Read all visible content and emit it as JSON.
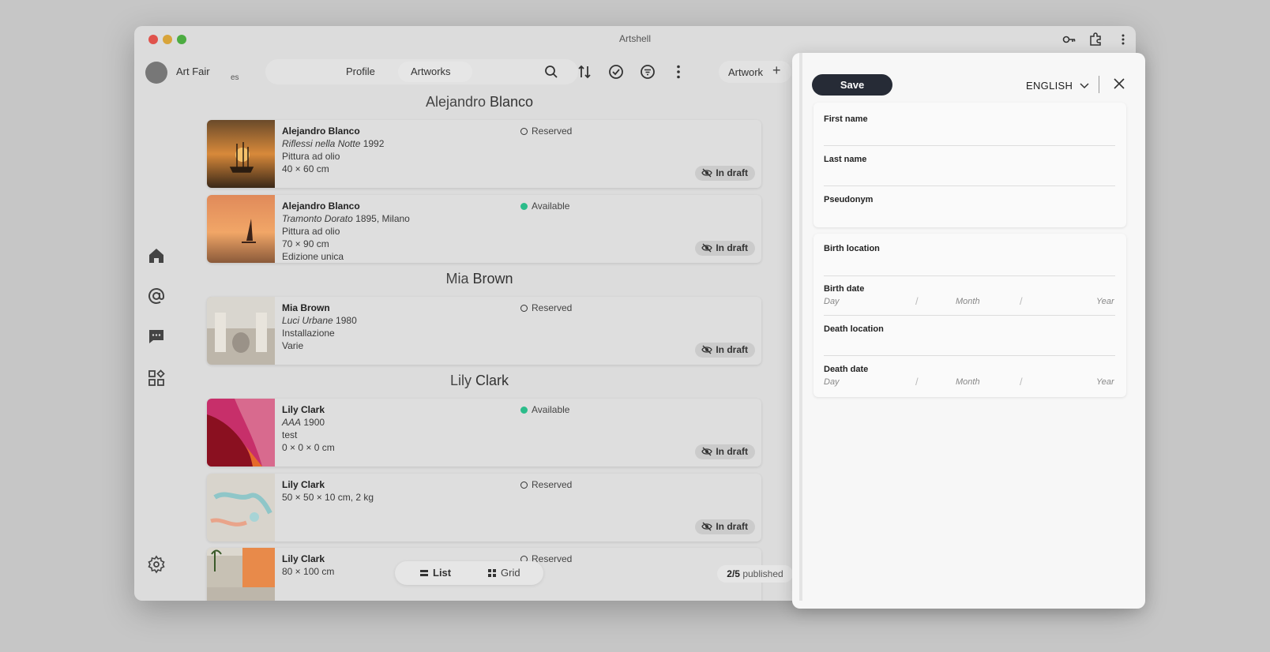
{
  "window": {
    "title": "Artshell"
  },
  "org": {
    "name": "Art Fair",
    "sub": "es"
  },
  "nav": {
    "tabs": [
      "Profile",
      "Artworks"
    ],
    "active": "Artworks"
  },
  "toolbar": {
    "artwork_label": "Artwork",
    "artwork_plus": "+"
  },
  "headings": {
    "h1": {
      "first": "Alejandro",
      "last": "Blanco"
    },
    "h2": {
      "first": "Mia",
      "last": "Brown"
    },
    "h3": {
      "first": "Lily",
      "last": "Clark"
    }
  },
  "cards": [
    {
      "artist": "Alejandro Blanco",
      "title_italic": "Riflessi nella Notte",
      "title_rest": " 1992",
      "l3": "Pittura ad olio",
      "l4": "40 × 60 cm",
      "l5": "",
      "status": "Reserved",
      "status_type": "reserved",
      "badge": "In draft"
    },
    {
      "artist": "Alejandro Blanco",
      "title_italic": "Tramonto Dorato",
      "title_rest": " 1895, Milano",
      "l3": "Pittura ad olio",
      "l4": "70 × 90 cm",
      "l5": "Edizione unica",
      "status": "Available",
      "status_type": "available",
      "badge": "In draft"
    },
    {
      "artist": "Mia Brown",
      "title_italic": "Luci Urbane",
      "title_rest": " 1980",
      "l3": "Installazione",
      "l4": "Varie",
      "l5": "",
      "status": "Reserved",
      "status_type": "reserved",
      "badge": "In draft"
    },
    {
      "artist": "Lily Clark",
      "title_italic": "AAA",
      "title_rest": " 1900",
      "l3": "test",
      "l4": "0 × 0 × 0 cm",
      "l5": "",
      "status": "Available",
      "status_type": "available",
      "badge": "In draft"
    },
    {
      "artist": "Lily Clark",
      "title_italic": "",
      "title_rest": "50 × 50 × 10 cm, 2 kg",
      "l3": "",
      "l4": "",
      "l5": "",
      "status": "Reserved",
      "status_type": "reserved",
      "badge": "In draft"
    },
    {
      "artist": "Lily Clark",
      "title_italic": "",
      "title_rest": "80 × 100 cm",
      "l3": "",
      "l4": "",
      "l5": "",
      "status": "Reserved",
      "status_type": "reserved",
      "badge": ""
    }
  ],
  "view_toggle": {
    "list": "List",
    "grid": "Grid"
  },
  "published": {
    "count": "2/5",
    "label": " published"
  },
  "panel": {
    "save": "Save",
    "language": "ENGLISH",
    "fields": {
      "first_name": "First name",
      "last_name": "Last name",
      "pseudonym": "Pseudonym",
      "birth_location": "Birth location",
      "birth_date": "Birth date",
      "death_location": "Death location",
      "death_date": "Death date"
    },
    "date_placeholders": {
      "day": "Day",
      "month": "Month",
      "year": "Year",
      "sep": "/"
    }
  }
}
